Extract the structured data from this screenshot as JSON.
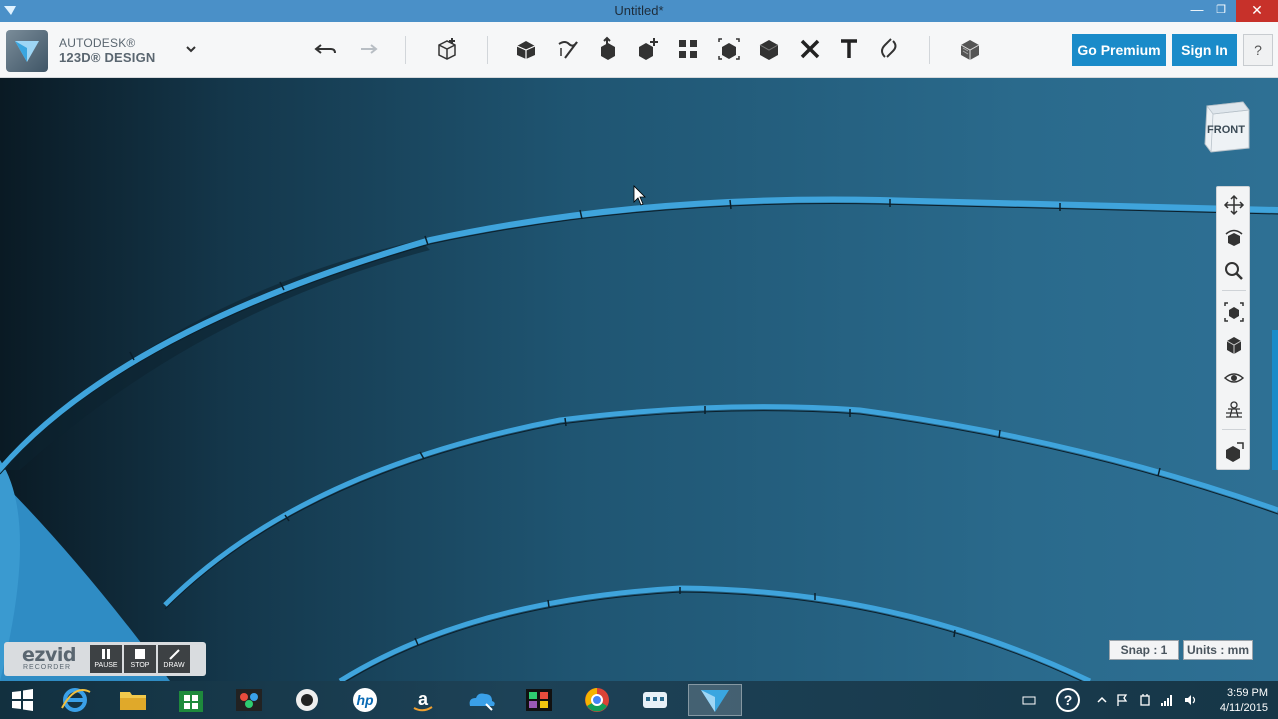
{
  "window": {
    "title": "Untitled*"
  },
  "brand": {
    "line1": "AUTODESK®",
    "line2": "123D® DESIGN"
  },
  "toolbar": {
    "icons": [
      "undo-icon",
      "redo-icon",
      "primitives-icon",
      "sketch-icon",
      "construct-icon",
      "modify-icon",
      "pattern-icon",
      "grouping-icon",
      "combine-icon",
      "measure-icon",
      "text-icon",
      "snap-icon",
      "material-icon"
    ],
    "go_premium": "Go Premium",
    "sign_in": "Sign In",
    "help": "?"
  },
  "viewcube": {
    "face": "FRONT"
  },
  "status": {
    "snap": "Snap : 1",
    "units": "Units : mm"
  },
  "ezvid": {
    "logo": "ezvid",
    "sub": "RECORDER",
    "pause": "PAUSE",
    "stop": "STOP",
    "draw": "DRAW"
  },
  "taskbar": {
    "apps": [
      "start-icon",
      "internet-explorer-icon",
      "file-explorer-icon",
      "store-icon",
      "photo-app-icon",
      "media-app-icon",
      "hp-icon",
      "amazon-icon",
      "onedrive-icon",
      "video-editor-icon",
      "chrome-icon",
      "network-app-icon",
      "123d-design-icon"
    ],
    "time": "3:59 PM",
    "date": "4/11/2015"
  },
  "colors": {
    "accent": "#1a8bc9",
    "close": "#c7312a",
    "titlebar": "#4a90c8"
  }
}
